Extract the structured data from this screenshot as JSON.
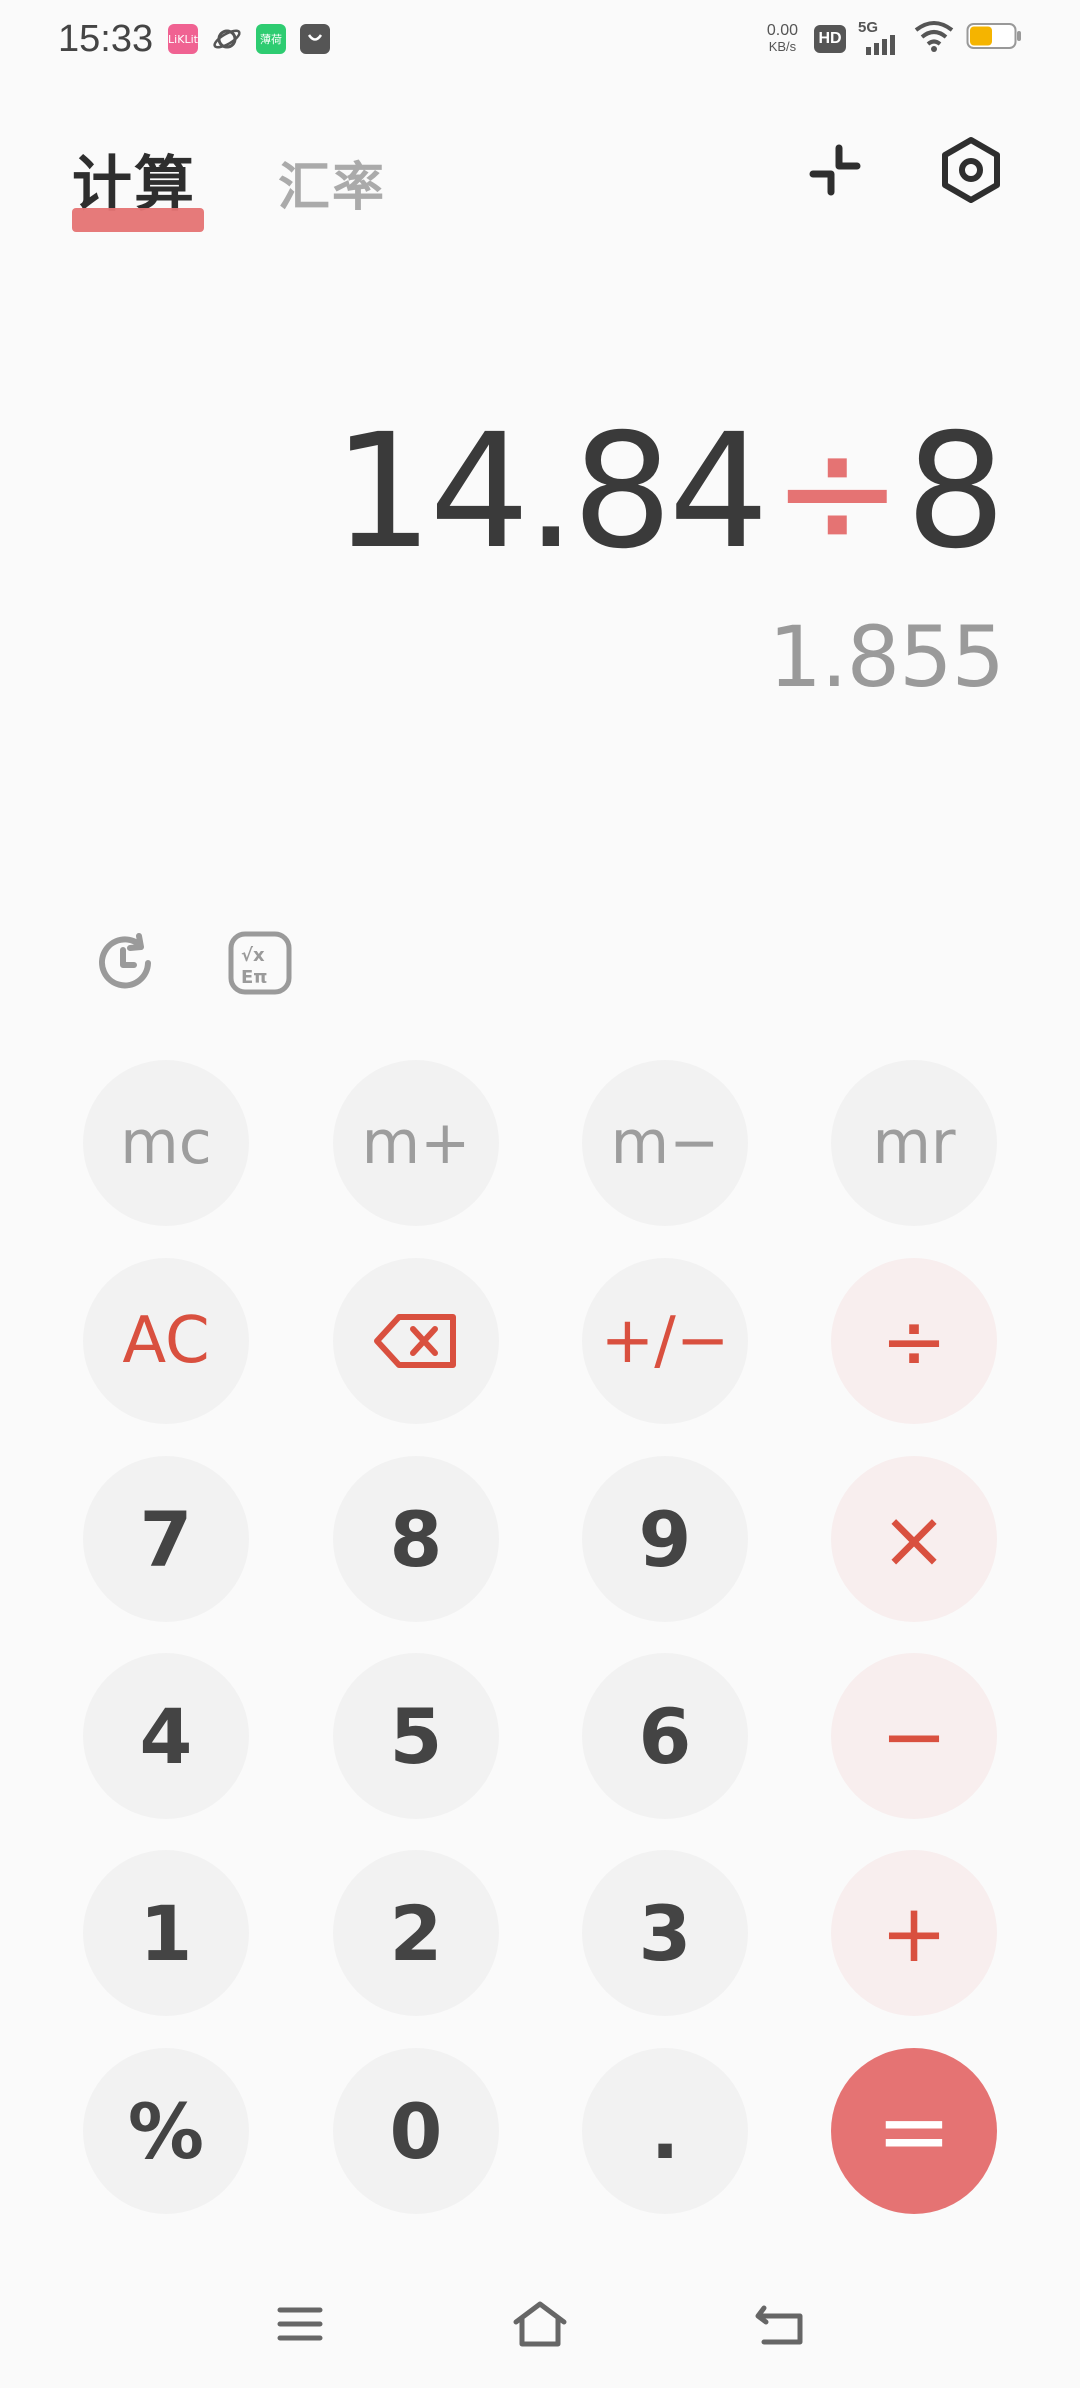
{
  "status_bar": {
    "time": "15:33",
    "notifications": [
      {
        "icon": "pink-app-icon",
        "text": "LiKLit"
      },
      {
        "icon": "planet-icon",
        "text": ""
      },
      {
        "icon": "green-app-icon",
        "text": "薄荷"
      },
      {
        "icon": "shopping-bag-icon",
        "text": ""
      }
    ],
    "net_speed_value": "0.00",
    "net_speed_unit": "KB/s",
    "hd_label": "HD",
    "network_label": "5G",
    "battery_color": "#f5b400"
  },
  "header": {
    "tab_calc": "计算",
    "tab_rate": "汇率",
    "accent_color": "#e57373",
    "collapse_icon": "collapse-arrows-icon",
    "settings_icon": "settings-hex-icon"
  },
  "display": {
    "operand1": "14.84",
    "operator": "÷",
    "operand2": "8",
    "result": "1.855"
  },
  "tools": {
    "history_icon": "history-icon",
    "scientific_icon": "scientific-mode-icon"
  },
  "keys": {
    "mc": "mc",
    "m_plus": "m+",
    "m_minus": "m−",
    "mr": "mr",
    "ac": "AC",
    "backspace_icon": "backspace-icon",
    "sign": "+/−",
    "divide": "÷",
    "seven": "7",
    "eight": "8",
    "nine": "9",
    "multiply": "×",
    "four": "4",
    "five": "5",
    "six": "6",
    "minus": "−",
    "one": "1",
    "two": "2",
    "three": "3",
    "plus": "+",
    "percent": "%",
    "zero": "0",
    "dot": ".",
    "equals": "="
  },
  "nav_bar": {
    "menu_icon": "menu-icon",
    "home_icon": "home-icon",
    "back_icon": "back-icon"
  }
}
